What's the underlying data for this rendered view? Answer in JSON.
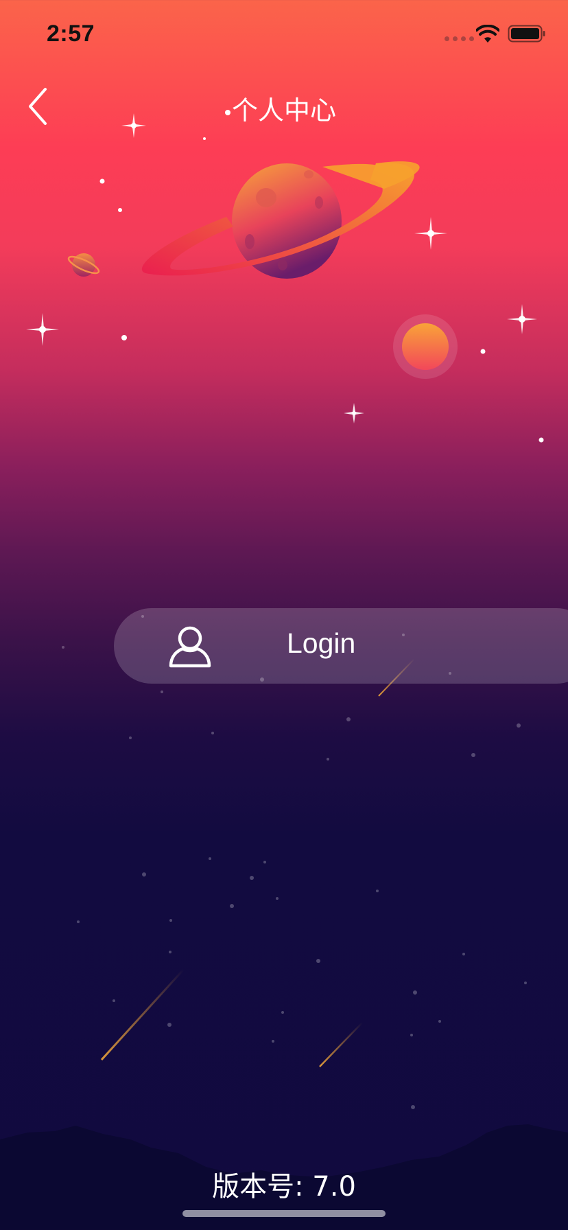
{
  "status_bar": {
    "time": "2:57",
    "wifi_icon": "wifi-icon",
    "battery_icon": "battery-icon"
  },
  "nav": {
    "back_icon": "chevron-left-icon",
    "title": "个人中心"
  },
  "login": {
    "icon": "user-icon",
    "label": "Login"
  },
  "footer": {
    "version_text": "版本号: 7.0"
  },
  "colors": {
    "gradient_top": "#fb644a",
    "gradient_mid": "#fd3d55",
    "gradient_bottom": "#110a3f",
    "planet_orange": "#f5a03a",
    "planet_pink": "#e8265a"
  }
}
